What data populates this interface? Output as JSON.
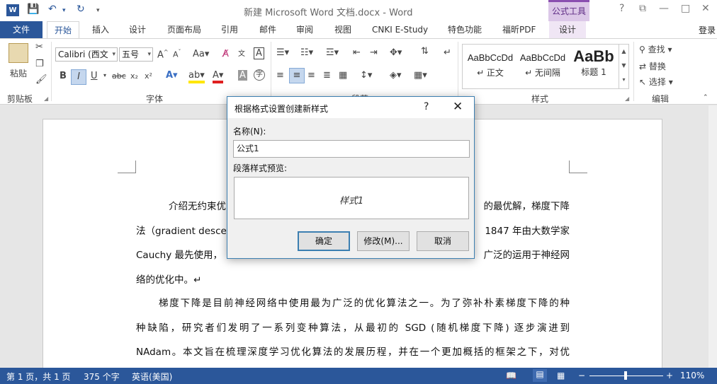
{
  "titlebar": {
    "app_icon_letter": "W",
    "title": "新建 Microsoft Word 文档.docx - Word",
    "contextual_tab": "公式工具",
    "help": "?",
    "restore_ribbon": "⧉",
    "minimize": "—",
    "maximize": "□",
    "close": "✕"
  },
  "tabs": {
    "file": "文件",
    "items": [
      "开始",
      "插入",
      "设计",
      "页面布局",
      "引用",
      "邮件",
      "审阅",
      "视图",
      "CNKI E-Study",
      "特色功能",
      "福昕PDF",
      "设计"
    ],
    "login": "登录"
  },
  "ribbon": {
    "clipboard": {
      "paste": "粘贴",
      "label": "剪贴板"
    },
    "font": {
      "font_name": "Calibri (西文",
      "font_size": "五号",
      "label": "字体",
      "bold": "B",
      "italic": "I",
      "underline": "U",
      "strike": "abc",
      "sub": "x₂",
      "sup": "x²"
    },
    "paragraph": {
      "label": "段落"
    },
    "styles": {
      "label": "样式",
      "items": [
        {
          "sample": "AaBbCcDd",
          "name": "↵ 正文"
        },
        {
          "sample": "AaBbCcDd",
          "name": "↵ 无间隔"
        },
        {
          "sample": "AaBb",
          "name": "标题 1"
        }
      ]
    },
    "editing": {
      "find": "查找",
      "replace": "替换",
      "select": "选择",
      "label": "编辑"
    }
  },
  "document": {
    "para1": [
      "介绍无约束优化问题的最优解，梯度下降",
      "法（gradient descent…1847 年由大数学家",
      "Cauchy 最先使用，…泛的运用于神经网",
      "络的优化中。↵"
    ],
    "para1_visible": {
      "line1_left": "介绍无约束优",
      "line1_right": "的最优解，梯度下降",
      "line2_left": "法（gradient descent",
      "line2_right": "1847  年由大数学家",
      "line3_left": "Cauchy  最先使用，",
      "line3_right": "广泛的运用于神经网",
      "line4": "络的优化中。↵"
    },
    "para2": [
      "梯度下降是目前神经网络中使用最为广泛的优化算法之一。为了弥补朴素梯度下降的种",
      "种缺陷，研究者们发明了一系列变种算法，从最初的  SGD (随机梯度下降)  逐步演进到",
      "NAdam。本文旨在梳理深度学习优化算法的发展历程，并在一个更加概括的框架之下，对优"
    ]
  },
  "statusbar": {
    "page": "第 1 页，共 1 页",
    "words": "375 个字",
    "language": "英语(美国)",
    "zoom_minus": "−",
    "zoom_plus": "+",
    "zoom": "110%"
  },
  "dialog": {
    "title": "根据格式设置创建新样式",
    "help": "?",
    "close": "✕",
    "name_label": "名称(N):",
    "name_value": "公式1",
    "preview_label": "段落样式预览:",
    "preview_text": "样式1",
    "ok": "确定",
    "modify": "修改(M)...",
    "cancel": "取消"
  }
}
